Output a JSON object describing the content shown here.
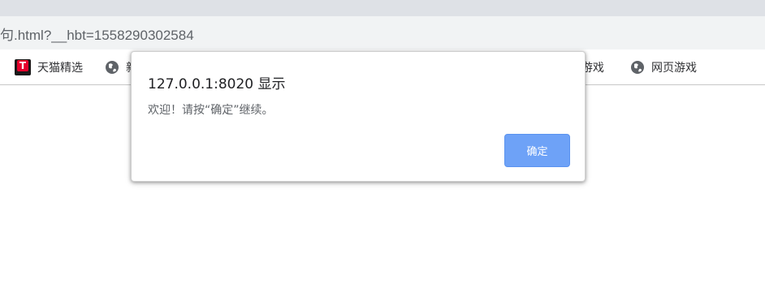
{
  "browser": {
    "address_url": "句.html?__hbt=1558290302584"
  },
  "bookmarks": [
    {
      "label": "天猫精选",
      "icon": "tmall-icon"
    },
    {
      "label": "新",
      "icon": "globe-icon"
    },
    {
      "label": "l游戏",
      "icon": ""
    },
    {
      "label": "网页游戏",
      "icon": "globe-icon"
    }
  ],
  "dialog": {
    "title": "127.0.0.1:8020 显示",
    "message": "欢迎！请按“确定”继续。",
    "ok_label": "确定"
  },
  "colors": {
    "ok_button": "#6ea2f7",
    "tmall_red": "#e4002b",
    "toolbar_bg": "#f1f3f4"
  }
}
